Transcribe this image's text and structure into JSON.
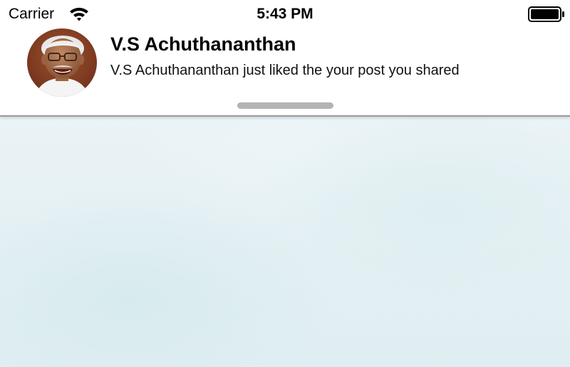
{
  "status_bar": {
    "carrier": "Carrier",
    "time": "5:43 PM",
    "wifi_icon": "wifi-icon",
    "battery_icon": "battery-full-icon"
  },
  "notification": {
    "avatar_icon": "user-avatar",
    "title": "V.S Achuthananthan",
    "message": "V.S Achuthananthan just liked the your post you shared"
  },
  "colors": {
    "banner_background": "#ffffff",
    "grabber": "#b3b3b3",
    "backdrop": "#e6f1f4"
  }
}
